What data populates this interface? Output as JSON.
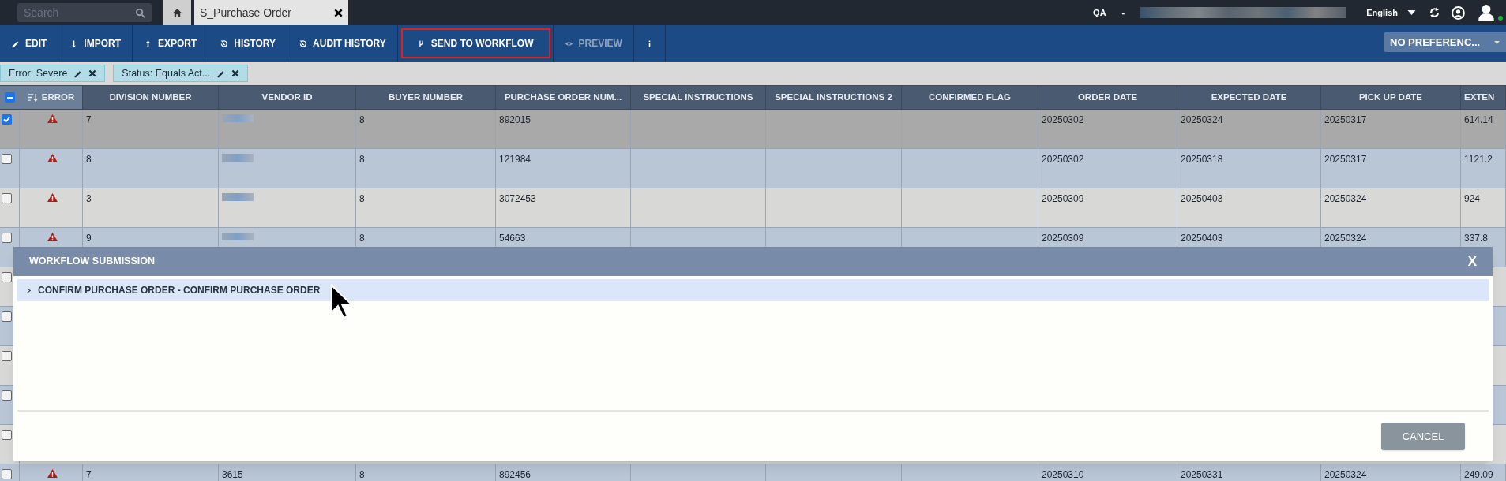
{
  "top_bar": {
    "search": {
      "placeholder": "Search"
    },
    "tabs": [
      {
        "kind": "home",
        "selected": false
      },
      {
        "kind": "text",
        "label": "S_Purchase Order",
        "selected": true
      }
    ],
    "environment": "QA",
    "separator": "-",
    "language": "English"
  },
  "toolbar": {
    "buttons": [
      {
        "label": "EDIT",
        "kind": "edit",
        "disabled": false,
        "highlighted": false
      },
      {
        "label": "IMPORT",
        "kind": "import",
        "disabled": false,
        "highlighted": false
      },
      {
        "label": "EXPORT",
        "kind": "export",
        "disabled": false,
        "highlighted": false
      },
      {
        "label": "HISTORY",
        "kind": "history",
        "disabled": false,
        "highlighted": false
      },
      {
        "label": "AUDIT HISTORY",
        "kind": "history",
        "disabled": false,
        "highlighted": false
      },
      {
        "label": "SEND TO WORKFLOW",
        "kind": "workflow",
        "disabled": false,
        "highlighted": true
      },
      {
        "label": "PREVIEW",
        "kind": "preview",
        "disabled": true,
        "highlighted": false
      },
      {
        "kind": "more",
        "disabled": false,
        "highlighted": false
      }
    ],
    "preference": "NO PREFERENC..."
  },
  "filters": [
    {
      "label": "Error: Severe"
    },
    {
      "label": "Status: Equals Act..."
    }
  ],
  "table": {
    "select_all": {
      "indeterminate": true
    },
    "columns": [
      {
        "label": "ERROR",
        "kind": "error",
        "sorted": true
      },
      {
        "label": "DIVISION NUMBER",
        "kind": "text",
        "sorted": false
      },
      {
        "label": "VENDOR ID",
        "kind": "redacted",
        "sorted": false
      },
      {
        "label": "BUYER NUMBER",
        "kind": "text",
        "sorted": false
      },
      {
        "label": "PURCHASE ORDER NUM...",
        "kind": "text",
        "sorted": false
      },
      {
        "label": "SPECIAL INSTRUCTIONS",
        "kind": "text",
        "sorted": false
      },
      {
        "label": "SPECIAL INSTRUCTIONS 2",
        "kind": "text",
        "sorted": false
      },
      {
        "label": "CONFIRMED FLAG",
        "kind": "text",
        "sorted": false
      },
      {
        "label": "ORDER DATE",
        "kind": "text",
        "sorted": false
      },
      {
        "label": "EXPECTED DATE",
        "kind": "text",
        "sorted": false
      },
      {
        "label": "PICK UP DATE",
        "kind": "text",
        "sorted": false
      },
      {
        "label": "EXTEN",
        "kind": "text",
        "sorted": false
      }
    ],
    "rows": [
      {
        "checked": true,
        "cells": [
          "",
          "7",
          "",
          "8",
          "892015",
          "",
          "",
          "",
          "20250302",
          "20250324",
          "20250317",
          "614.14"
        ]
      },
      {
        "checked": false,
        "cells": [
          "",
          "8",
          "",
          "8",
          "121984",
          "",
          "",
          "",
          "20250302",
          "20250318",
          "20250317",
          "1121.2"
        ]
      },
      {
        "checked": false,
        "cells": [
          "",
          "3",
          "",
          "8",
          "3072453",
          "",
          "",
          "",
          "20250309",
          "20250403",
          "20250324",
          "924"
        ]
      },
      {
        "checked": false,
        "cells": [
          "",
          "9",
          "",
          "8",
          "54663",
          "",
          "",
          "",
          "20250309",
          "20250403",
          "20250324",
          "337.8"
        ]
      },
      {
        "checked": false,
        "cells": []
      },
      {
        "checked": false,
        "cells": []
      },
      {
        "checked": false,
        "cells": []
      },
      {
        "checked": false,
        "cells": []
      },
      {
        "checked": false,
        "cells": []
      },
      {
        "checked": false,
        "cells": [
          "",
          "7",
          "3615",
          "8",
          "892456",
          "",
          "",
          "",
          "20250310",
          "20250331",
          "20250324",
          "249.09"
        ]
      }
    ]
  },
  "modal": {
    "title": "WORKFLOW SUBMISSION",
    "close": "X",
    "items": [
      {
        "label": "CONFIRM PURCHASE ORDER - CONFIRM PURCHASE ORDER",
        "expanded": false,
        "selected": true
      }
    ],
    "buttons": [
      "CANCEL"
    ]
  }
}
